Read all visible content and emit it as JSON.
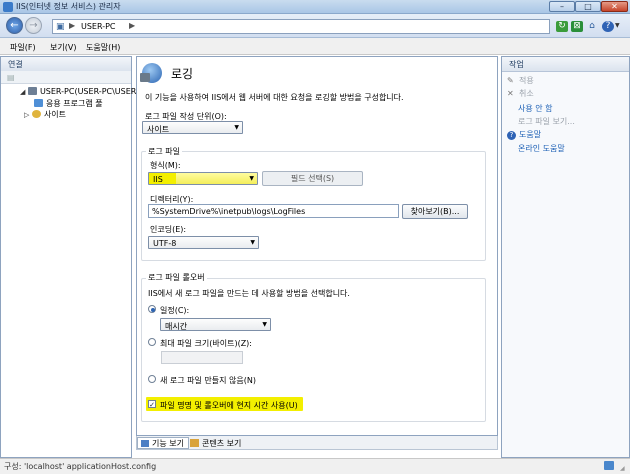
{
  "window": {
    "title": "IIS(인터넷 정보 서비스) 관리자"
  },
  "address": {
    "server": "USER-PC"
  },
  "menu": {
    "file": "파일(F)",
    "view": "보기(V)",
    "help": "도움말(H)"
  },
  "connections": {
    "header": "연결",
    "tree": [
      {
        "label": "USER-PC(USER-PC\\USER)",
        "icon": "server-icon"
      },
      {
        "label": "응용 프로그램 풀",
        "icon": "app-pools-icon"
      },
      {
        "label": "사이트",
        "icon": "sites-icon"
      }
    ]
  },
  "main": {
    "title": "로깅",
    "description": "이 기능을 사용하여 IIS에서 웹 서버에 대한 요청을 로깅할 방법을 구성합니다.",
    "unit_label": "로그 파일 작성 단위(O):",
    "unit_value": "사이트",
    "logfile": {
      "legend": "로그 파일",
      "format_label": "형식(M):",
      "format_value": "IIS",
      "fields_button": "필드 선택(S)",
      "directory_label": "디렉터리(Y):",
      "directory_value": "%SystemDrive%\\inetpub\\logs\\LogFiles",
      "browse_button": "찾아보기(B)...",
      "encoding_label": "인코딩(E):",
      "encoding_value": "UTF-8"
    },
    "rollover": {
      "legend": "로그 파일 롤오버",
      "description": "IIS에서 새 로그 파일을 만드는 데 사용할 방법을 선택합니다.",
      "schedule_label": "일정(C):",
      "schedule_value": "매시간",
      "size_label": "최대 파일 크기(바이트)(Z):",
      "size_value": "",
      "none_label": "새 로그 파일 만들지 않음(N)",
      "utc_label": "파일 명명 및 롤오버에 현지 시간 사용(U)",
      "utc_checked": true,
      "selected": "schedule"
    }
  },
  "tabs": {
    "features": "기능 보기",
    "content": "콘텐츠 보기"
  },
  "actions": {
    "header": "작업",
    "apply": "적용",
    "cancel": "취소",
    "disable": "사용 안 함",
    "view_log": "로그 파일 보기...",
    "help": "도움말",
    "online_help": "온라인 도움말"
  },
  "status": {
    "text": "구성: 'localhost' applicationHost.config"
  }
}
